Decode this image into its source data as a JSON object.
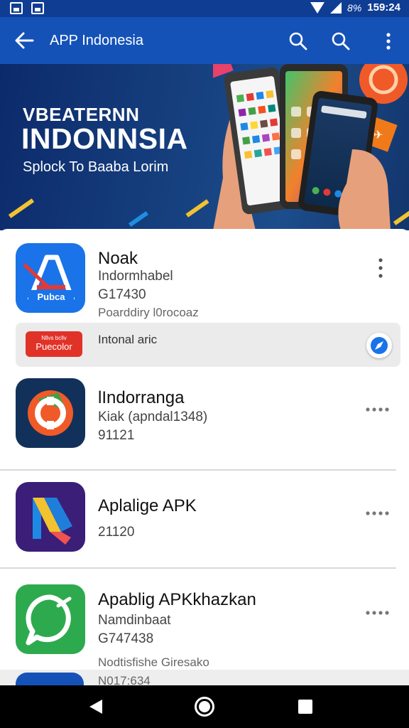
{
  "status_bar": {
    "battery_percent": "8%",
    "time": "159:24",
    "icons": [
      "gallery-icon",
      "photo-icon",
      "wifi-icon",
      "signal-icon"
    ]
  },
  "app_bar": {
    "title": "APP Indonesia",
    "back_icon": "arrow-left-icon",
    "actions": [
      "search-icon",
      "search-icon",
      "more-vert-icon"
    ],
    "color": "#1552b8"
  },
  "banner": {
    "subtitle": "VBEATERNN",
    "title": "INDONNSIA",
    "tagline": "Splock To Baaba Lorim"
  },
  "apps": [
    {
      "name": "Noak",
      "lines": [
        "Indormhabel",
        "G17430",
        "Poarddiry l0rocoaz"
      ],
      "icon_text": "Pubca",
      "menu": "kebab-vertical-icon"
    },
    {
      "name": "lIndorranga",
      "lines": [
        "Kiak (apndal1348)",
        "91121"
      ],
      "menu": "kebab-horizontal-icon"
    },
    {
      "name": "Aplalige APK",
      "lines": [
        "21120"
      ],
      "menu": "kebab-horizontal-icon"
    },
    {
      "name": "Apablig APKkhazkan",
      "lines": [
        "Namdinbaat",
        "G747438",
        "Nodtisfishe Giresako",
        "N017:634"
      ],
      "menu": "kebab-horizontal-icon"
    }
  ],
  "promo": {
    "badge_top": "Nllvs bcllv",
    "badge_main": "Puecolor",
    "text": "Intonal aric",
    "action_icon": "compass-check-icon"
  },
  "nav": [
    "nav-back-icon",
    "nav-home-icon",
    "nav-recent-icon"
  ]
}
